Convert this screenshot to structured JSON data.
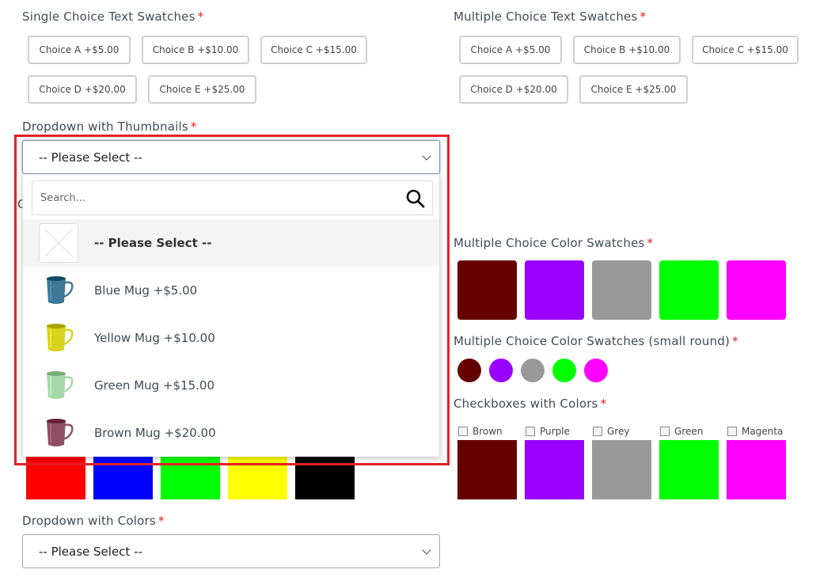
{
  "single_text_swatches": {
    "label": "Single Choice Text Swatches",
    "required_mark": "*",
    "options": [
      "Choice A +$5.00",
      "Choice B +$10.00",
      "Choice C +$15.00",
      "Choice D +$20.00",
      "Choice E +$25.00"
    ]
  },
  "multi_text_swatches": {
    "label": "Multiple Choice Text Swatches",
    "required_mark": "*",
    "options": [
      "Choice A +$5.00",
      "Choice B +$10.00",
      "Choice C +$15.00",
      "Choice D +$20.00",
      "Choice E +$25.00"
    ]
  },
  "dropdown_thumbnails": {
    "label": "Dropdown with Thumbnails",
    "required_mark": "*",
    "selected_value": "-- Please Select --",
    "search_placeholder": "Search...",
    "search_icon": "search-icon",
    "options": [
      {
        "label": "-- Please Select --",
        "thumb": "placeholder-x",
        "selected": true
      },
      {
        "label": "Blue Mug +$5.00",
        "thumb": "blue-mug",
        "color": "#3e7896"
      },
      {
        "label": "Yellow Mug +$10.00",
        "thumb": "yellow-mug",
        "color": "#d8d21c"
      },
      {
        "label": "Green Mug +$15.00",
        "thumb": "green-mug",
        "color": "#a4d8a8"
      },
      {
        "label": "Brown Mug +$20.00",
        "thumb": "brown-mug",
        "color": "#8e4f64"
      }
    ]
  },
  "left_color_swatches": {
    "colors": [
      "#ff0000",
      "#0000ff",
      "#00ff00",
      "#ffff00",
      "#000000"
    ]
  },
  "multi_color_swatches": {
    "label": "Multiple Choice Color Swatches",
    "required_mark": "*",
    "colors": [
      "#660000",
      "#9900ff",
      "#999999",
      "#00ff00",
      "#ff00ff"
    ]
  },
  "multi_color_round": {
    "label": "Multiple Choice Color Swatches (small round)",
    "required_mark": "*",
    "colors": [
      "#660000",
      "#9900ff",
      "#999999",
      "#00ff00",
      "#ff00ff"
    ]
  },
  "checkbox_colors": {
    "label": "Checkboxes with Colors",
    "required_mark": "*",
    "items": [
      {
        "label": "Brown",
        "color": "#660000",
        "checked": false
      },
      {
        "label": "Purple",
        "color": "#9900ff",
        "checked": false
      },
      {
        "label": "Grey",
        "color": "#999999",
        "checked": false
      },
      {
        "label": "Green",
        "color": "#00ff00",
        "checked": false
      },
      {
        "label": "Magenta",
        "color": "#ff00ff",
        "checked": false
      }
    ]
  },
  "dropdown_colors": {
    "label": "Dropdown with Colors",
    "required_mark": "*",
    "selected_value": "-- Please Select --"
  },
  "theme": {
    "required_color": "#e01b1b",
    "highlight_color": "#e32026"
  }
}
